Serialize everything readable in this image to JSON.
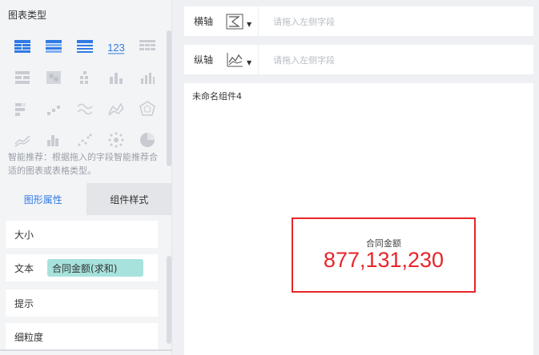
{
  "left_panel": {
    "chart_type_title": "图表类型",
    "icons": [
      "table-icon",
      "cross-table-icon",
      "detail-table-icon",
      "kpi-number-icon",
      "multi-table-icon",
      "grouped-table-icon",
      "heatmap-icon",
      "dot-column-icon",
      "column-chart-icon",
      "bar-chart-icon",
      "stacked-bar-icon",
      "step-chart-icon",
      "line-wave-icon",
      "radar-line-icon",
      "radar-icon",
      "area-line-icon",
      "histogram-icon",
      "scatter-icon",
      "bubble-icon",
      "pie-chart-icon"
    ],
    "smart_tip": "智能推荐：根据拖入的字段智能推荐合适的图表或表格类型。",
    "tabs": {
      "graphic": "图形属性",
      "style": "组件样式"
    },
    "properties": {
      "size": "大小",
      "text": "文本",
      "text_tag": "合同金额(求和)",
      "tooltip": "提示",
      "granularity": "细粒度"
    }
  },
  "axes": {
    "x_label": "横轴",
    "y_label": "纵轴",
    "placeholder": "请拖入左侧字段"
  },
  "canvas": {
    "component_name": "未命名组件4",
    "kpi_label": "合同金额",
    "kpi_value": "877,131,230"
  },
  "colors": {
    "accent": "#2f7ae5",
    "kpi_red": "#e5252a",
    "tag_bg": "#a7e2dc"
  }
}
